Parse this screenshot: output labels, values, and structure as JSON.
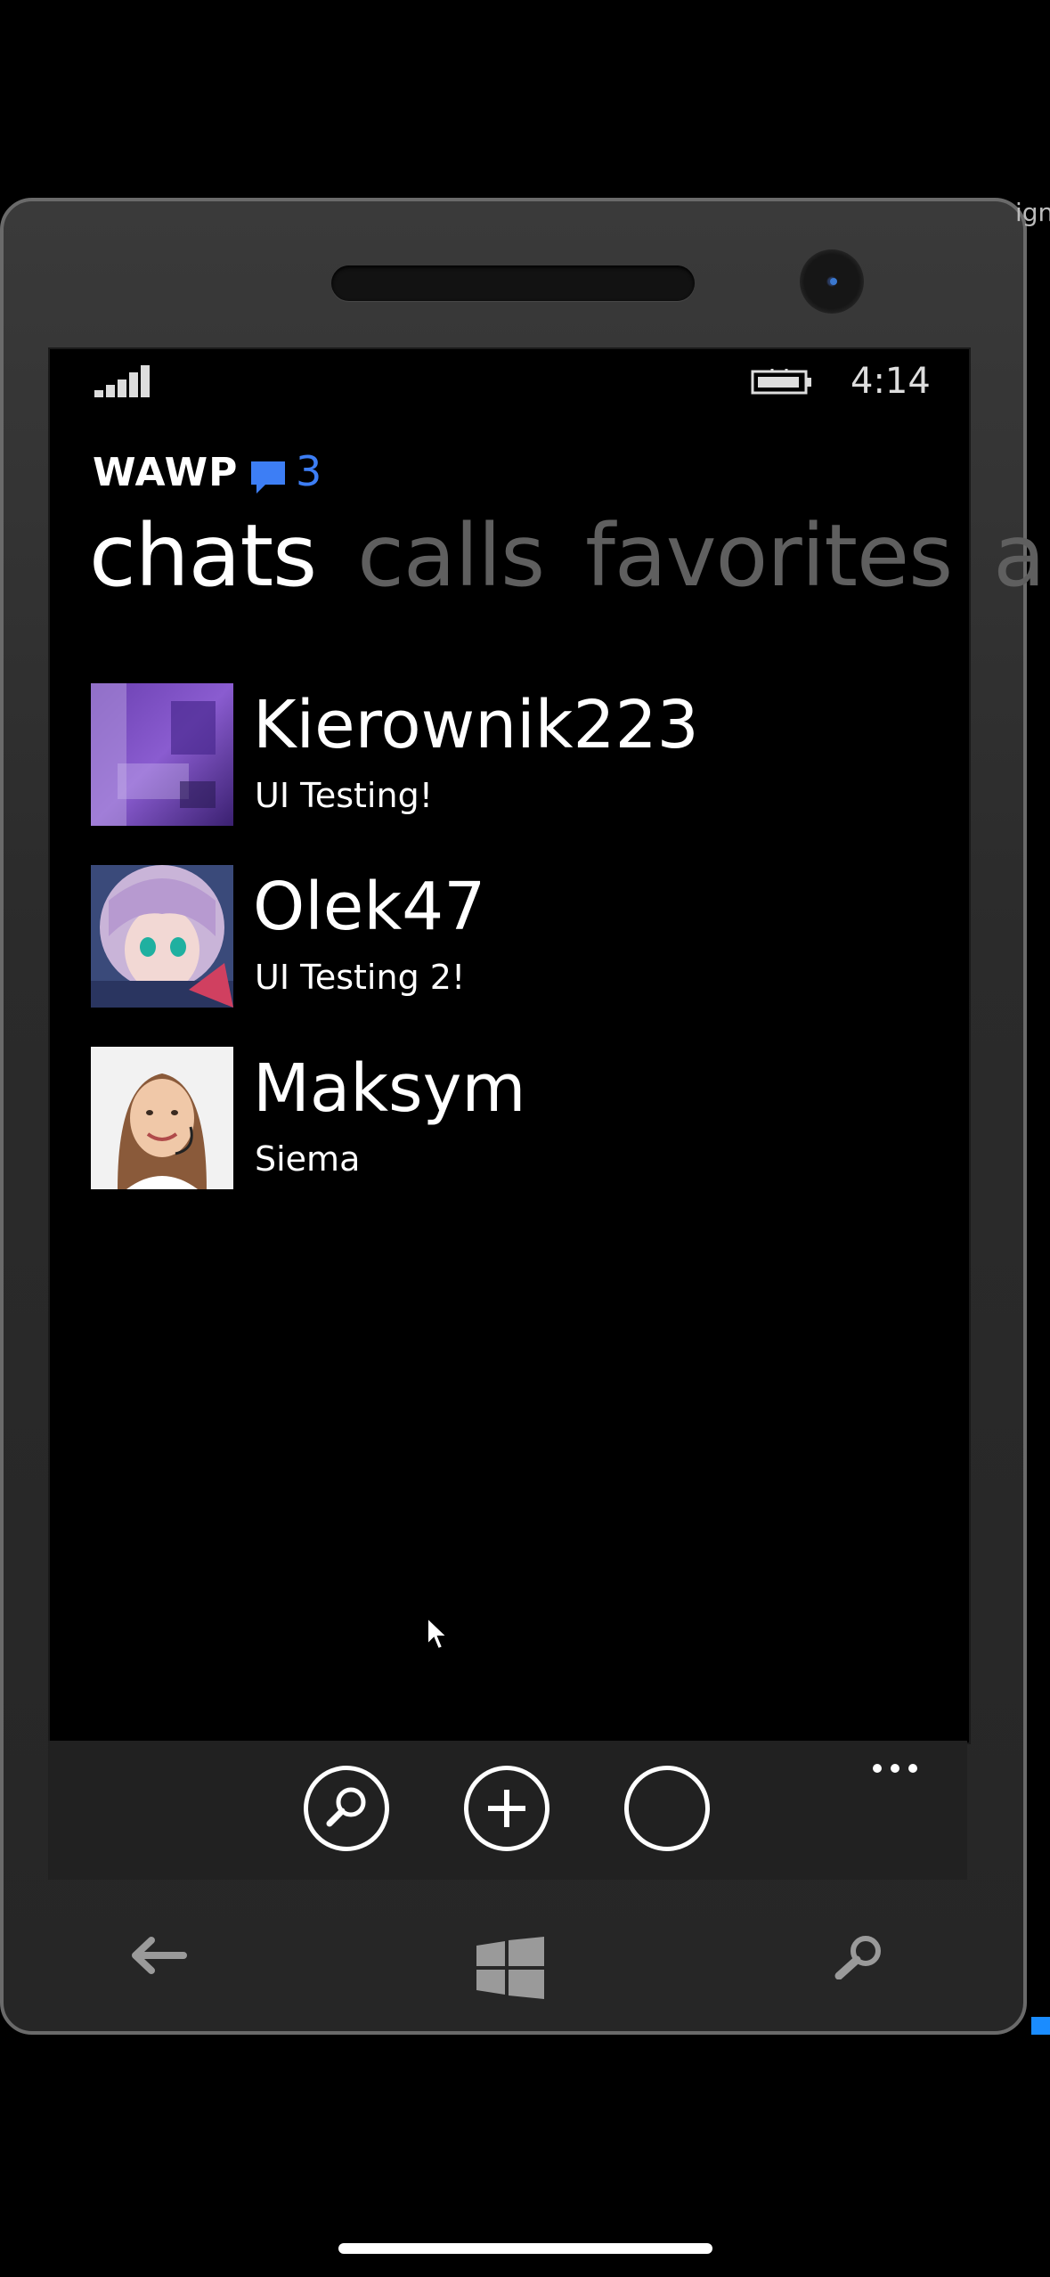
{
  "status_bar": {
    "time": "4:14"
  },
  "header": {
    "app_title": "WAWP",
    "unread_count": "3",
    "badge_icon": "chat-bubble-icon",
    "accent_color": "#3d7ef5"
  },
  "pivot": {
    "tabs": [
      {
        "label": "chats",
        "active": true
      },
      {
        "label": "calls",
        "active": false
      },
      {
        "label": "favorites",
        "active": false
      },
      {
        "label": "a",
        "active": false
      }
    ]
  },
  "chats": [
    {
      "name": "Kierownik223",
      "last_message": "UI Testing!",
      "avatar": "purple-photo-avatar"
    },
    {
      "name": "Olek47",
      "last_message": "UI Testing 2!",
      "avatar": "anime-girl-avatar"
    },
    {
      "name": "Maksym",
      "last_message": "Siema",
      "avatar": "woman-headset-avatar"
    }
  ],
  "app_bar": {
    "buttons": [
      {
        "icon": "search-icon"
      },
      {
        "icon": "add-icon"
      },
      {
        "icon": "empty-circle-icon"
      }
    ],
    "more_icon": "ellipsis-icon"
  },
  "hardware_buttons": [
    "back-arrow-icon",
    "windows-logo-icon",
    "search-icon"
  ],
  "desktop_edge_text": "ign"
}
